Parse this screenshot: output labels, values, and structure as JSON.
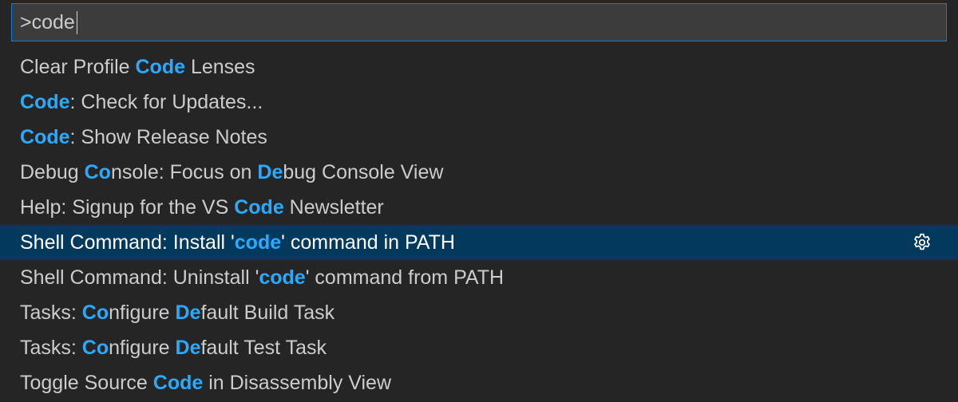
{
  "input": {
    "value": ">code"
  },
  "items": [
    {
      "segments": [
        {
          "t": "Clear Profile ",
          "h": false
        },
        {
          "t": "Code",
          "h": true
        },
        {
          "t": " Lenses",
          "h": false
        }
      ]
    },
    {
      "segments": [
        {
          "t": "Code",
          "h": true
        },
        {
          "t": ": Check for Updates...",
          "h": false
        }
      ]
    },
    {
      "segments": [
        {
          "t": "Code",
          "h": true
        },
        {
          "t": ": Show Release Notes",
          "h": false
        }
      ]
    },
    {
      "segments": [
        {
          "t": "Debug ",
          "h": false
        },
        {
          "t": "Co",
          "h": true
        },
        {
          "t": "nsole: Focus on ",
          "h": false
        },
        {
          "t": "De",
          "h": true
        },
        {
          "t": "bug Console View",
          "h": false
        }
      ]
    },
    {
      "segments": [
        {
          "t": "Help: Signup for the VS ",
          "h": false
        },
        {
          "t": "Code",
          "h": true
        },
        {
          "t": " Newsletter",
          "h": false
        }
      ]
    },
    {
      "segments": [
        {
          "t": "Shell Command: Install '",
          "h": false
        },
        {
          "t": "code",
          "h": true
        },
        {
          "t": "' command in PATH",
          "h": false
        }
      ],
      "selected": true,
      "gear_icon": "gear-icon"
    },
    {
      "segments": [
        {
          "t": "Shell Command: Uninstall '",
          "h": false
        },
        {
          "t": "code",
          "h": true
        },
        {
          "t": "' command from PATH",
          "h": false
        }
      ]
    },
    {
      "segments": [
        {
          "t": "Tasks: ",
          "h": false
        },
        {
          "t": "Co",
          "h": true
        },
        {
          "t": "nfigure ",
          "h": false
        },
        {
          "t": "De",
          "h": true
        },
        {
          "t": "fault Build Task",
          "h": false
        }
      ]
    },
    {
      "segments": [
        {
          "t": "Tasks: ",
          "h": false
        },
        {
          "t": "Co",
          "h": true
        },
        {
          "t": "nfigure ",
          "h": false
        },
        {
          "t": "De",
          "h": true
        },
        {
          "t": "fault Test Task",
          "h": false
        }
      ]
    },
    {
      "segments": [
        {
          "t": "Toggle Source ",
          "h": false
        },
        {
          "t": "Code",
          "h": true
        },
        {
          "t": " in Disassembly View",
          "h": false
        }
      ]
    }
  ],
  "colors": {
    "background": "#252526",
    "input_background": "#3c3c3c",
    "input_border": "#0e7bd4",
    "selection": "#04395e",
    "highlight": "#2aaaff",
    "text": "#cccccc"
  }
}
